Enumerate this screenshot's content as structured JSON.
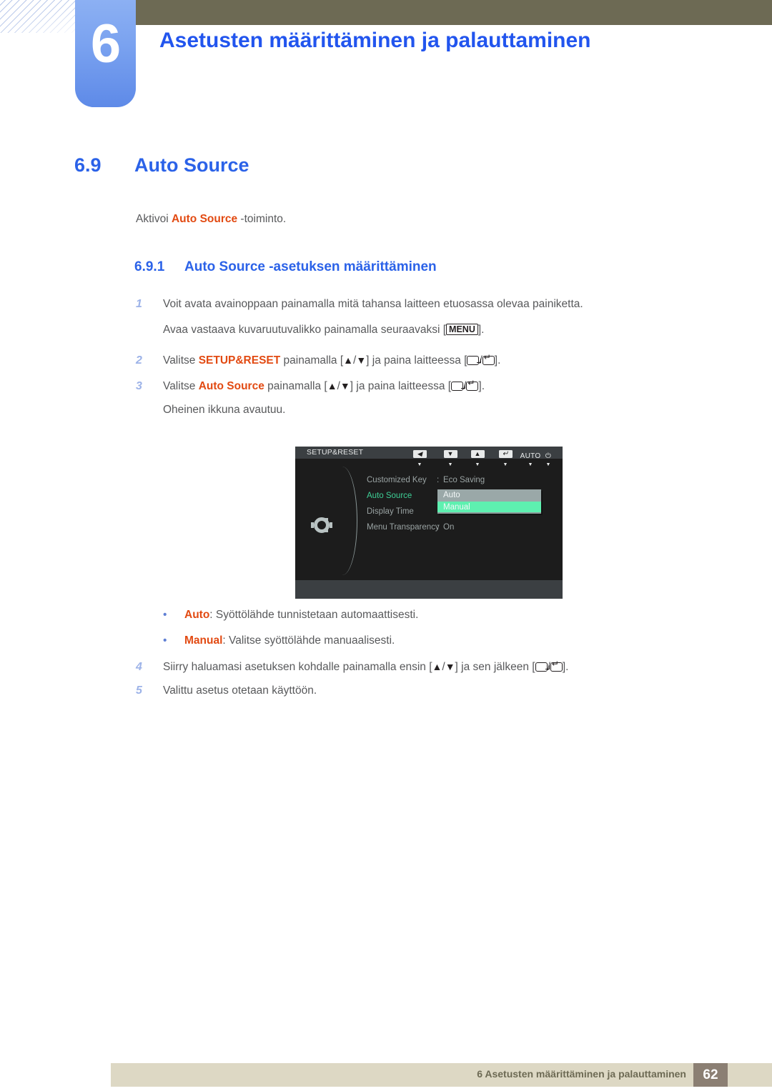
{
  "header": {
    "chapter_number": "6",
    "chapter_title": "Asetusten määrittäminen ja palauttaminen",
    "bar_color": "#6d6a54",
    "tab_color": "#7ba3f0",
    "title_color": "#2255ee"
  },
  "section": {
    "number": "6.9",
    "title": "Auto Source",
    "intro_before": "Aktivoi ",
    "intro_highlight": "Auto Source",
    "intro_after": " -toiminto.",
    "highlight_color": "#e24a12"
  },
  "subsection": {
    "number": "6.9.1",
    "title": "Auto Source -asetuksen määrittäminen"
  },
  "steps": [
    {
      "num": "1",
      "text_parts": [
        "Voit avata avainoppaan painamalla mitä tahansa laitteen etuosassa olevaa painiketta."
      ],
      "sub_before": "Avaa vastaava kuvaruutuvalikko painamalla seuraavaksi [",
      "sub_key": "MENU",
      "sub_after": "]."
    },
    {
      "num": "2",
      "before": "Valitse ",
      "highlight": "SETUP&RESET",
      "middle": " painamalla [",
      "after_keys": "] ja paina laitteessa [",
      "end": "]."
    },
    {
      "num": "3",
      "before": "Valitse ",
      "highlight": "Auto Source",
      "middle": " painamalla [",
      "after_keys": "] ja paina laitteessa [",
      "end": "].",
      "sub_text": "Oheinen ikkuna avautuu."
    },
    {
      "num": "4",
      "before": "Siirry haluamasi asetuksen kohdalle painamalla ensin [",
      "middle": "] ja sen jälkeen [",
      "end": "]."
    },
    {
      "num": "5",
      "text": "Valittu asetus otetaan käyttöön."
    }
  ],
  "bullets": [
    {
      "marker": "•",
      "term": "Auto",
      "desc": ": Syöttölähde tunnistetaan automaattisesti."
    },
    {
      "marker": "•",
      "term": "Manual",
      "desc": ": Valitse syöttölähde manuaalisesti."
    }
  ],
  "osd": {
    "title": "SETUP&RESET",
    "up_arrow": "▲",
    "rows": [
      {
        "label": "Customized Key",
        "colon": ":",
        "value": "Eco Saving",
        "active": false
      },
      {
        "label": "Auto Source",
        "colon": ":",
        "value": "",
        "active": true
      },
      {
        "label": "Display Time",
        "colon": ":",
        "value": "",
        "active": false
      },
      {
        "label": "Menu Transparency",
        "colon": ":",
        "value": "On",
        "active": false
      }
    ],
    "dropdown": {
      "options": [
        "Auto",
        "Manual"
      ],
      "selected": "Manual",
      "unselected_bg": "#9aa8a8",
      "selected_bg": "#5ef0b0"
    },
    "buttons": [
      {
        "name": "left-arrow-button",
        "glyph": "◀",
        "sub": "▼"
      },
      {
        "name": "down-arrow-button",
        "glyph": "▼",
        "sub": "▼"
      },
      {
        "name": "up-arrow-button",
        "glyph": "▲",
        "sub": "▼"
      },
      {
        "name": "enter-button",
        "glyph": "↵",
        "sub": "▼"
      },
      {
        "name": "auto-button",
        "label": "AUTO",
        "sub": "▼"
      },
      {
        "name": "power-button",
        "label": "⏻",
        "sub": "▼"
      }
    ],
    "bg_color": "#1c1c1c",
    "bar_color": "#3b3f42",
    "text_color": "#9aa3a3",
    "active_color": "#3ecf96"
  },
  "footer": {
    "text": "6 Asetusten määrittäminen ja palauttaminen",
    "page": "62",
    "bar_color": "#ddd8c4",
    "page_box_color": "#8b7f73"
  }
}
